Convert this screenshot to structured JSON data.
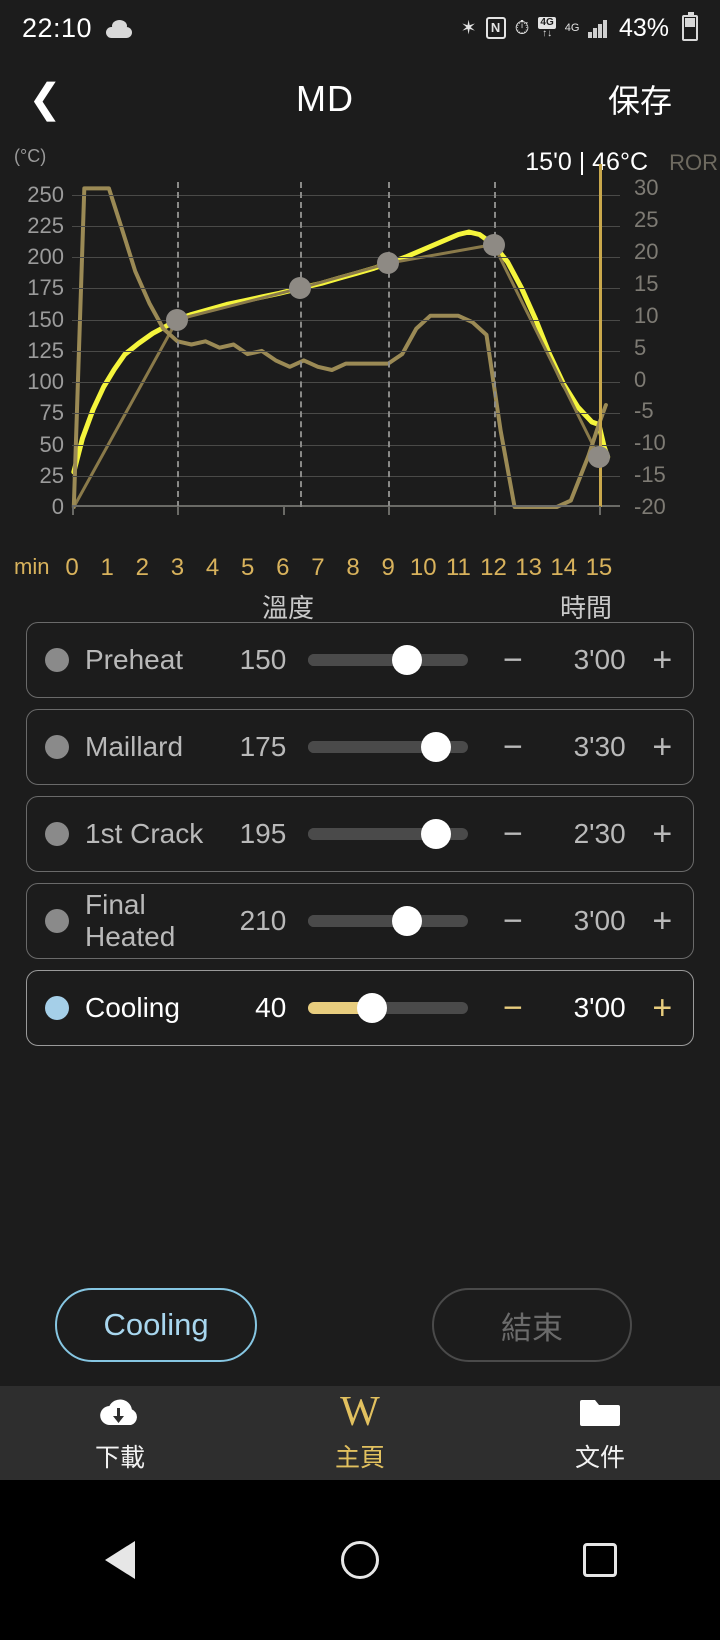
{
  "statusbar": {
    "time": "22:10",
    "cloud_icon": "cloud-icon",
    "bluetooth": "✶",
    "nfc": "N",
    "alarm": "⏱",
    "data_4g_box": "4G",
    "data_arrows": "↑↓",
    "data_4g_small": "4G",
    "battery_percent": "43%"
  },
  "header": {
    "back_icon": "chevron-left-icon",
    "title": "MD",
    "save_label": "保存"
  },
  "chart_data": {
    "type": "line",
    "title": "",
    "unit_label": "(°C)",
    "readout": "15'0 | 46°C",
    "right_axis_label": "ROR",
    "xlabel": "min",
    "ylabel": "(°C)",
    "xlim": [
      0,
      15.6
    ],
    "ylim": [
      0,
      260
    ],
    "y2lim": [
      -20,
      31
    ],
    "grid": true,
    "legend_position": "none",
    "x_ticks": [
      "0",
      "1",
      "2",
      "3",
      "4",
      "5",
      "6",
      "7",
      "8",
      "9",
      "10",
      "11",
      "12",
      "13",
      "14",
      "15"
    ],
    "y_ticks_left": [
      "250",
      "225",
      "200",
      "175",
      "150",
      "125",
      "100",
      "75",
      "50",
      "25",
      "0"
    ],
    "y_ticks_right": [
      "30",
      "25",
      "20",
      "15",
      "10",
      "5",
      "0",
      "-5",
      "-10",
      "-15",
      "-20"
    ],
    "phase_markers_x": [
      3,
      6.5,
      9,
      12
    ],
    "now_line_x": 15,
    "series": [
      {
        "name": "bean-temperature",
        "color": "#f5f53c",
        "points": [
          [
            0.05,
            28
          ],
          [
            0.3,
            55
          ],
          [
            0.6,
            78
          ],
          [
            0.9,
            96
          ],
          [
            1.2,
            110
          ],
          [
            1.5,
            122
          ],
          [
            1.9,
            131
          ],
          [
            2.3,
            139
          ],
          [
            2.7,
            145
          ],
          [
            3.0,
            150
          ],
          [
            3.4,
            154
          ],
          [
            3.9,
            158
          ],
          [
            4.4,
            162
          ],
          [
            4.9,
            165
          ],
          [
            5.4,
            168
          ],
          [
            5.9,
            171
          ],
          [
            6.5,
            175
          ],
          [
            7.1,
            179
          ],
          [
            7.6,
            183
          ],
          [
            8.1,
            187
          ],
          [
            8.6,
            191
          ],
          [
            9.0,
            195
          ],
          [
            9.5,
            200
          ],
          [
            10.0,
            206
          ],
          [
            10.5,
            212
          ],
          [
            11.0,
            218
          ],
          [
            11.3,
            220
          ],
          [
            11.6,
            218
          ],
          [
            12.0,
            210
          ],
          [
            12.4,
            196
          ],
          [
            12.8,
            175
          ],
          [
            13.2,
            150
          ],
          [
            13.6,
            122
          ],
          [
            14.0,
            98
          ],
          [
            14.4,
            80
          ],
          [
            14.8,
            68
          ],
          [
            15.0,
            66
          ],
          [
            15.15,
            48
          ],
          [
            15.25,
            40
          ]
        ]
      },
      {
        "name": "target-profile",
        "color": "#8a7a4a",
        "points": [
          [
            0.05,
            0
          ],
          [
            3.0,
            150
          ],
          [
            6.5,
            175
          ],
          [
            9.0,
            195
          ],
          [
            12.0,
            210
          ],
          [
            15.0,
            40
          ]
        ]
      },
      {
        "name": "ror-curve",
        "color": "#9b8a55",
        "points": [
          [
            0.05,
            -20
          ],
          [
            0.35,
            30
          ],
          [
            1.05,
            30
          ],
          [
            1.4,
            24
          ],
          [
            1.8,
            17
          ],
          [
            2.2,
            12
          ],
          [
            2.6,
            8
          ],
          [
            3.0,
            6
          ],
          [
            3.4,
            5.5
          ],
          [
            3.8,
            6
          ],
          [
            4.2,
            5
          ],
          [
            4.6,
            5.5
          ],
          [
            5.0,
            4
          ],
          [
            5.4,
            4.5
          ],
          [
            5.8,
            3
          ],
          [
            6.2,
            2
          ],
          [
            6.6,
            3
          ],
          [
            7.0,
            2
          ],
          [
            7.4,
            1.5
          ],
          [
            7.8,
            2.5
          ],
          [
            8.2,
            2.5
          ],
          [
            8.6,
            2.5
          ],
          [
            9.0,
            2.5
          ],
          [
            9.4,
            4
          ],
          [
            9.8,
            8
          ],
          [
            10.2,
            10
          ],
          [
            10.6,
            10
          ],
          [
            11.0,
            10
          ],
          [
            11.4,
            9
          ],
          [
            11.8,
            7
          ],
          [
            12.2,
            -8
          ],
          [
            12.6,
            -20
          ],
          [
            13.2,
            -20
          ],
          [
            13.8,
            -20
          ],
          [
            14.2,
            -19
          ],
          [
            14.7,
            -12
          ],
          [
            15.0,
            -7
          ],
          [
            15.2,
            -4
          ]
        ]
      }
    ],
    "annotations": [
      {
        "x": 3,
        "y": 150,
        "type": "marker"
      },
      {
        "x": 6.5,
        "y": 175,
        "type": "marker"
      },
      {
        "x": 9,
        "y": 195,
        "type": "marker"
      },
      {
        "x": 12,
        "y": 210,
        "type": "marker"
      },
      {
        "x": 15,
        "y": 40,
        "type": "marker"
      }
    ]
  },
  "table": {
    "col_temp": "溫度",
    "col_time": "時間",
    "minus_label": "−",
    "plus_label": "+",
    "rows": [
      {
        "name": "Preheat",
        "temp": "150",
        "time": "3'00",
        "slider_pct": 62,
        "active": false,
        "dot": "grey"
      },
      {
        "name": "Maillard",
        "temp": "175",
        "time": "3'30",
        "slider_pct": 80,
        "active": false,
        "dot": "grey"
      },
      {
        "name": "1st Crack",
        "temp": "195",
        "time": "2'30",
        "slider_pct": 80,
        "active": false,
        "dot": "grey"
      },
      {
        "name": "Final Heated",
        "temp": "210",
        "time": "3'00",
        "slider_pct": 62,
        "active": false,
        "dot": "grey"
      },
      {
        "name": "Cooling",
        "temp": "40",
        "time": "3'00",
        "slider_pct": 40,
        "active": true,
        "dot": "blue"
      }
    ]
  },
  "actions": {
    "cooling_label": "Cooling",
    "end_label": "結束"
  },
  "bottomnav": {
    "items": [
      {
        "label": "下載",
        "icon": "cloud-download-icon",
        "selected": false
      },
      {
        "label": "主頁",
        "icon": "w-logo-icon",
        "selected": true
      },
      {
        "label": "文件",
        "icon": "folder-icon",
        "selected": false
      }
    ]
  },
  "sysnav": {
    "back": "back-triangle-icon",
    "home": "home-circle-icon",
    "recents": "recents-square-icon"
  },
  "colors": {
    "background": "#1c1c1c",
    "accent_gold": "#e2c15f",
    "accent_blue": "#a8d6ee",
    "bean_curve": "#f5f53c",
    "ror_curve": "#9b8a55"
  }
}
